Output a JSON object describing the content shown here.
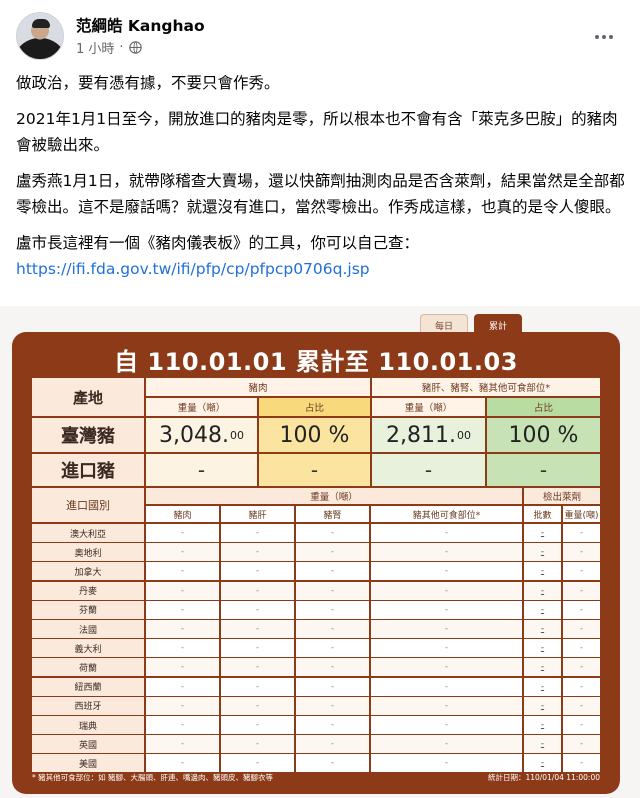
{
  "post": {
    "author": "范綱皓 Kanghao",
    "time": "1 小時",
    "separator": "·",
    "paragraphs": [
      "做政治，要有憑有據，不要只會作秀。",
      "2021年1月1日至今，開放進口的豬肉是零，所以根本也不會有含「萊克多巴胺」的豬肉會被驗出來。",
      "盧秀燕1月1日，就帶隊稽查大賣場，還以快篩劑抽測肉品是否含萊劑，結果當然是全部都零檢出。這不是廢話嗎？就還沒有進口，當然零檢出。作秀成這樣，也真的是令人傻眼。",
      "盧市長這裡有一個《豬肉儀表板》的工具，你可以自己查："
    ],
    "link": "https://ifi.fda.gov.tw/ifi/pfp/cp/pfpcp0706q.jsp"
  },
  "icons": {
    "globe": "globe-icon",
    "more": "more-options-icon"
  },
  "dashboard": {
    "tabs": {
      "daily": "每日",
      "cumulative": "累計"
    },
    "title": "自 110.01.01 累計至 110.01.03",
    "summary": {
      "origin_header": "產地",
      "pork_header": "豬肉",
      "other_header": "豬肝、豬腎、豬其他可食部位*",
      "weight_label": "重量（噸）",
      "share_label": "占比",
      "taiwan": {
        "label": "臺灣豬",
        "pork_weight": "3,048.",
        "pork_weight_dec": "00",
        "pork_share": "100 %",
        "other_weight": "2,811.",
        "other_weight_dec": "00",
        "other_share": "100 %"
      },
      "imported": {
        "label": "進口豬",
        "pork_weight": "-",
        "pork_share": "-",
        "other_weight": "-",
        "other_share": "-"
      }
    },
    "detail": {
      "country_header": "進口國別",
      "weight_header": "重量（噸）",
      "tested_header": "檢出萊劑",
      "cols": [
        "豬肉",
        "豬肝",
        "豬腎",
        "豬其他可食部位*",
        "批數",
        "重量(噸)"
      ],
      "countries": [
        "澳大利亞",
        "奧地利",
        "加拿大",
        "丹麥",
        "芬蘭",
        "法國",
        "義大利",
        "荷蘭",
        "紐西蘭",
        "西班牙",
        "瑞典",
        "英國",
        "美國"
      ],
      "dash": "-"
    },
    "footnote": "* 豬其他可食部位：如 豬腳、大腸頭、肝連、嘴邊肉、豬頭皮、豬腳衣等",
    "stat_date": "統計日期：110/01/04 11:00:00"
  },
  "colors": {
    "board": "#8c3a17",
    "link": "#216fdb",
    "meta": "#65676b"
  }
}
